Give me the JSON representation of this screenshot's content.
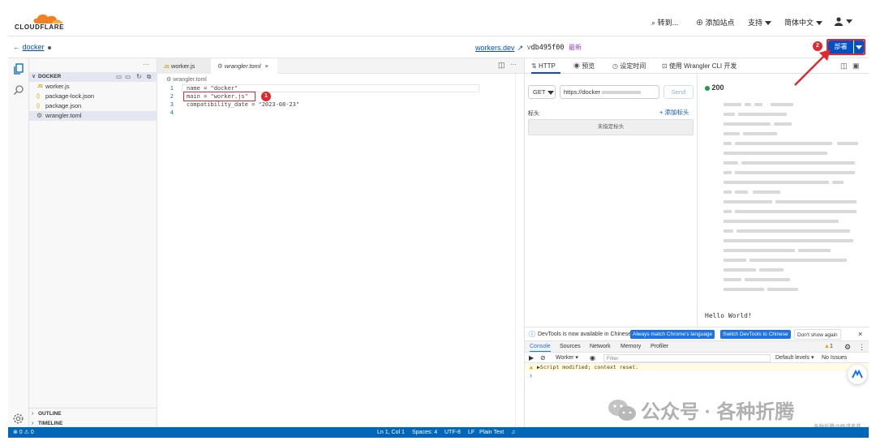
{
  "topbar": {
    "logo_text": "CLOUDFLARE",
    "goto": "转到...",
    "add_site": "添加站点",
    "support": "支持",
    "language": "简体中文"
  },
  "subbar": {
    "back_label": "docker",
    "workers_link": "workers.dev",
    "version_prefix": "v",
    "version_hash": "db495f00",
    "latest_label": "最新",
    "deploy_label": "部署",
    "marker2": "2"
  },
  "explorer": {
    "root_label": "DOCKER",
    "files": [
      {
        "name": "worker.js",
        "type": "JS"
      },
      {
        "name": "package-lock.json",
        "type": "{}"
      },
      {
        "name": "package.json",
        "type": "{}"
      },
      {
        "name": "wrangler.toml",
        "type": "gear"
      }
    ],
    "outline_label": "OUTLINE",
    "timeline_label": "TIMELINE",
    "more_glyph": "···"
  },
  "editor": {
    "tabs": [
      {
        "label": "worker.js",
        "prefix": "JS"
      },
      {
        "label": "wrangler.toml"
      }
    ],
    "breadcrumb": "wrangler.toml",
    "lines": [
      {
        "num": "1",
        "text": "name = \"docker\""
      },
      {
        "num": "2",
        "text": "main = \"worker.js\""
      },
      {
        "num": "3",
        "text": "compatibility_date = \"2023-08-23\""
      },
      {
        "num": "4",
        "text": ""
      }
    ],
    "marker1": "1"
  },
  "statusbar": {
    "problems": "⊗ 0 ⚠ 0",
    "position": "Ln 1, Col 1",
    "spaces": "Spaces: 4",
    "encoding": "UTF-8",
    "eol": "LF",
    "language": "Plain Text"
  },
  "preview": {
    "tabs": [
      "HTTP",
      "预览",
      "设定时间",
      "使用 Wrangler CLI 开发"
    ],
    "method": "GET",
    "url": "https://docker",
    "send_label": "Send",
    "headers_label": "标头",
    "add_header_label": "添加标头",
    "no_headers_label": "未指定标头",
    "status_code": "200",
    "response_body": "Hello World!"
  },
  "devtools": {
    "banner_text": "DevTools is now available in Chinese!",
    "match_btn": "Always match Chrome's language",
    "switch_btn": "Switch DevTools to Chinese",
    "dont_show": "Don't show again",
    "tabs": [
      "Console",
      "Sources",
      "Network",
      "Memory",
      "Profiler"
    ],
    "warning_count": "1",
    "context_select": "Worker",
    "filter_placeholder": "Filter",
    "levels": "Default levels",
    "issues": "No Issues",
    "warning_message": "▶Script modified; context reset.",
    "prompt": "›"
  },
  "watermark": {
    "brand": "公众号 · 各种折腾",
    "credit": "各种折腾@杨浦老苏"
  },
  "colors": {
    "accent": "#0051c3",
    "status_green": "#1a9e47",
    "annotation_red": "#e0282e",
    "cloudflare_orange": "#f38020",
    "statusbar_blue": "#0066b8"
  }
}
